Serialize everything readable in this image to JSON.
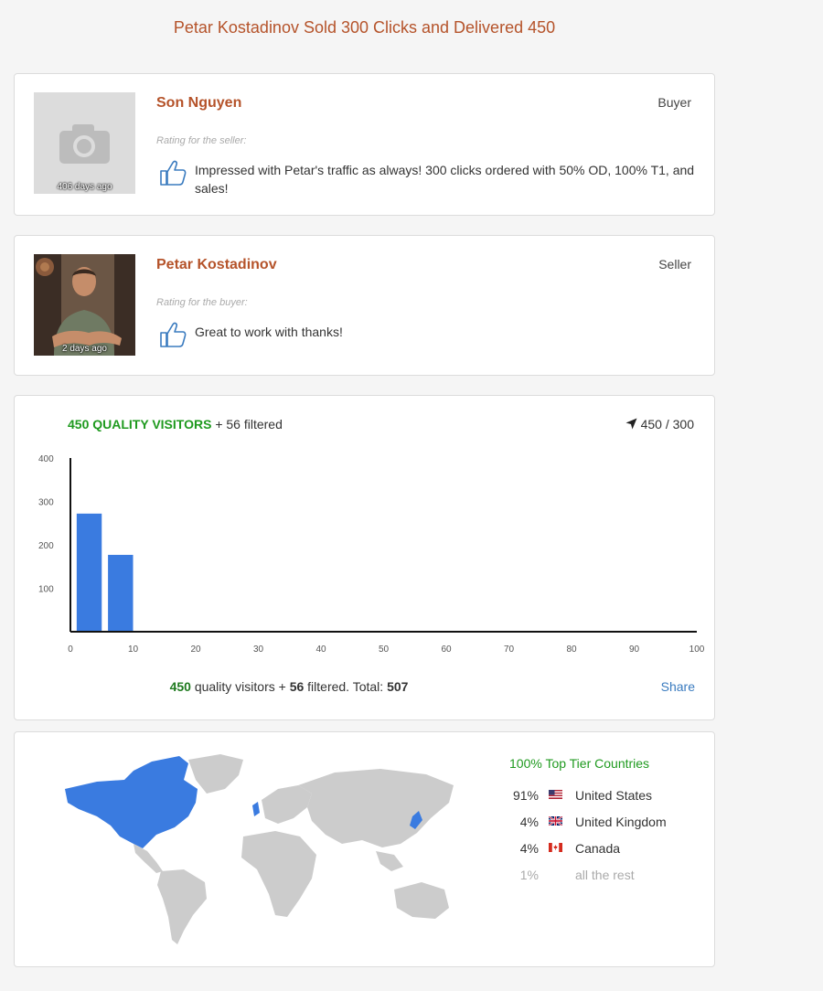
{
  "header": {
    "title": "Petar Kostadinov Sold 300 Clicks and Delivered 450"
  },
  "reviews": [
    {
      "name": "Son Nguyen",
      "role": "Buyer",
      "age": "406 days ago",
      "rating_label": "Rating for the seller:",
      "comment": "Impressed with Petar's traffic as always! 300 clicks ordered with 50% OD, 100% T1, and sales!",
      "avatar_icon": "camera-placeholder-icon"
    },
    {
      "name": "Petar Kostadinov",
      "role": "Seller",
      "age": "2 days ago",
      "rating_label": "Rating for the buyer:",
      "comment": "Great to work with thanks!",
      "avatar_icon": "profile-photo"
    }
  ],
  "stats": {
    "quality_label": "450 QUALITY VISITORS",
    "filtered_label": "+ 56 filtered",
    "delivered": "450 / 300",
    "footer_quality": "450",
    "footer_quality_text": "quality visitors +",
    "footer_filtered": "56",
    "footer_filtered_text": "filtered. Total:",
    "footer_total": "507",
    "share_label": "Share",
    "colors": {
      "green": "#1f9a1f",
      "bar": "#3a7be0",
      "link": "#3a7bbf"
    }
  },
  "chart_data": {
    "type": "bar",
    "x_ticks": [
      "0",
      "10",
      "20",
      "30",
      "40",
      "50",
      "60",
      "70",
      "80",
      "90",
      "100"
    ],
    "y_ticks": [
      "100",
      "200",
      "300",
      "400"
    ],
    "xlim": [
      0,
      100
    ],
    "ylim": [
      0,
      400
    ],
    "bars": [
      {
        "x_start": 1,
        "x_end": 5,
        "value": 272
      },
      {
        "x_start": 6,
        "x_end": 10,
        "value": 177
      }
    ],
    "grid": false
  },
  "geo": {
    "tier_label": "100% Top Tier Countries",
    "countries": [
      {
        "pct": "91%",
        "name": "United States",
        "flag": "us-flag-icon"
      },
      {
        "pct": "4%",
        "name": "United Kingdom",
        "flag": "uk-flag-icon"
      },
      {
        "pct": "4%",
        "name": "Canada",
        "flag": "ca-flag-icon"
      }
    ],
    "rest": {
      "pct": "1%",
      "name": "all the rest"
    },
    "colors": {
      "highlight": "#3a7be0",
      "land": "#cccccc"
    }
  }
}
